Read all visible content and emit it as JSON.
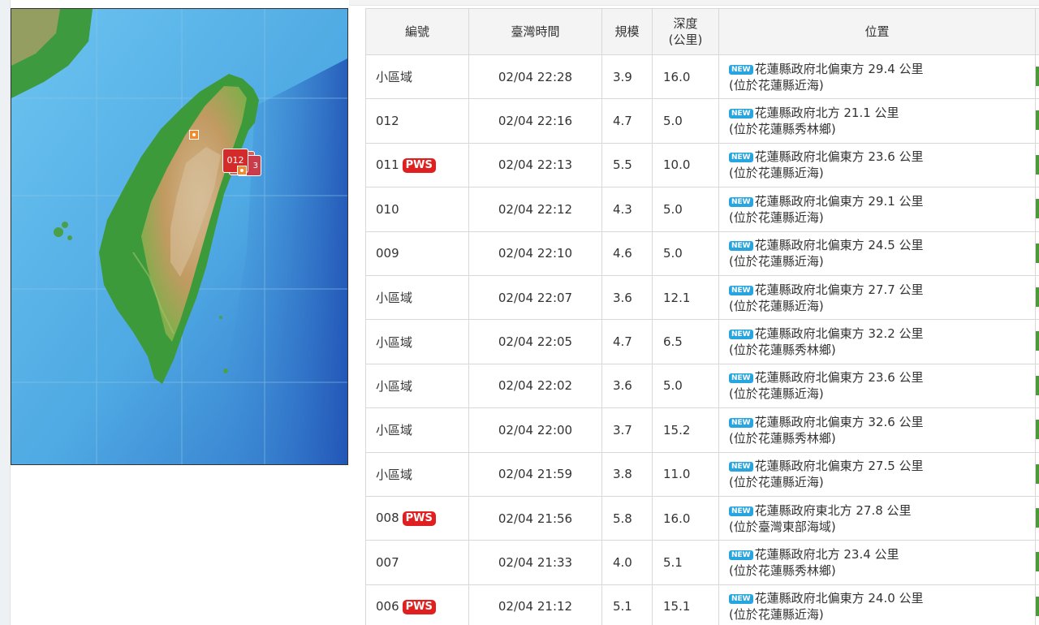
{
  "table": {
    "headers": {
      "id": "編號",
      "time": "臺灣時間",
      "magnitude": "規模",
      "depth_line1": "深度",
      "depth_line2": "(公里)",
      "location": "位置"
    },
    "rows": [
      {
        "id": "小區域",
        "pws": false,
        "time": "02/04 22:28",
        "magnitude": "3.9",
        "depth": "16.0",
        "loc1": "花蓮縣政府北偏東方 29.4 公里",
        "loc2": "(位於花蓮縣近海)"
      },
      {
        "id": "012",
        "pws": false,
        "time": "02/04 22:16",
        "magnitude": "4.7",
        "depth": "5.0",
        "loc1": "花蓮縣政府北方 21.1 公里",
        "loc2": "(位於花蓮縣秀林鄉)"
      },
      {
        "id": "011",
        "pws": true,
        "time": "02/04 22:13",
        "magnitude": "5.5",
        "depth": "10.0",
        "loc1": "花蓮縣政府北偏東方 23.6 公里",
        "loc2": "(位於花蓮縣近海)"
      },
      {
        "id": "010",
        "pws": false,
        "time": "02/04 22:12",
        "magnitude": "4.3",
        "depth": "5.0",
        "loc1": "花蓮縣政府北偏東方 29.1 公里",
        "loc2": "(位於花蓮縣近海)"
      },
      {
        "id": "009",
        "pws": false,
        "time": "02/04 22:10",
        "magnitude": "4.6",
        "depth": "5.0",
        "loc1": "花蓮縣政府北偏東方 24.5 公里",
        "loc2": "(位於花蓮縣近海)"
      },
      {
        "id": "小區域",
        "pws": false,
        "time": "02/04 22:07",
        "magnitude": "3.6",
        "depth": "12.1",
        "loc1": "花蓮縣政府北偏東方 27.7 公里",
        "loc2": "(位於花蓮縣近海)"
      },
      {
        "id": "小區域",
        "pws": false,
        "time": "02/04 22:05",
        "magnitude": "4.7",
        "depth": "6.5",
        "loc1": "花蓮縣政府北偏東方 32.2 公里",
        "loc2": "(位於花蓮縣秀林鄉)"
      },
      {
        "id": "小區域",
        "pws": false,
        "time": "02/04 22:02",
        "magnitude": "3.6",
        "depth": "5.0",
        "loc1": "花蓮縣政府北偏東方 23.6 公里",
        "loc2": "(位於花蓮縣近海)"
      },
      {
        "id": "小區域",
        "pws": false,
        "time": "02/04 22:00",
        "magnitude": "3.7",
        "depth": "15.2",
        "loc1": "花蓮縣政府北偏東方 32.6 公里",
        "loc2": "(位於花蓮縣秀林鄉)"
      },
      {
        "id": "小區域",
        "pws": false,
        "time": "02/04 21:59",
        "magnitude": "3.8",
        "depth": "11.0",
        "loc1": "花蓮縣政府北偏東方 27.5 公里",
        "loc2": "(位於花蓮縣近海)"
      },
      {
        "id": "008",
        "pws": true,
        "time": "02/04 21:56",
        "magnitude": "5.8",
        "depth": "16.0",
        "loc1": "花蓮縣政府東北方 27.8 公里",
        "loc2": "(位於臺灣東部海域)"
      },
      {
        "id": "007",
        "pws": false,
        "time": "02/04 21:33",
        "magnitude": "4.0",
        "depth": "5.1",
        "loc1": "花蓮縣政府北方 23.4 公里",
        "loc2": "(位於花蓮縣秀林鄉)"
      },
      {
        "id": "006",
        "pws": true,
        "time": "02/04 21:12",
        "magnitude": "5.1",
        "depth": "15.1",
        "loc1": "花蓮縣政府北偏東方 24.0 公里",
        "loc2": "(位於花蓮縣近海)"
      }
    ]
  },
  "badges": {
    "pws": "PWS",
    "new": "NEW"
  },
  "map": {
    "marker_label": "012",
    "marker_label_partial": "3"
  },
  "colors": {
    "pws": "#e02020",
    "new_badge": "#28a4df",
    "sea": "#5ab4e6",
    "land_low": "#3c9a3c",
    "land_high": "#c8a878"
  },
  "icons": {
    "map_marker": "epicenter-marker-icon"
  }
}
